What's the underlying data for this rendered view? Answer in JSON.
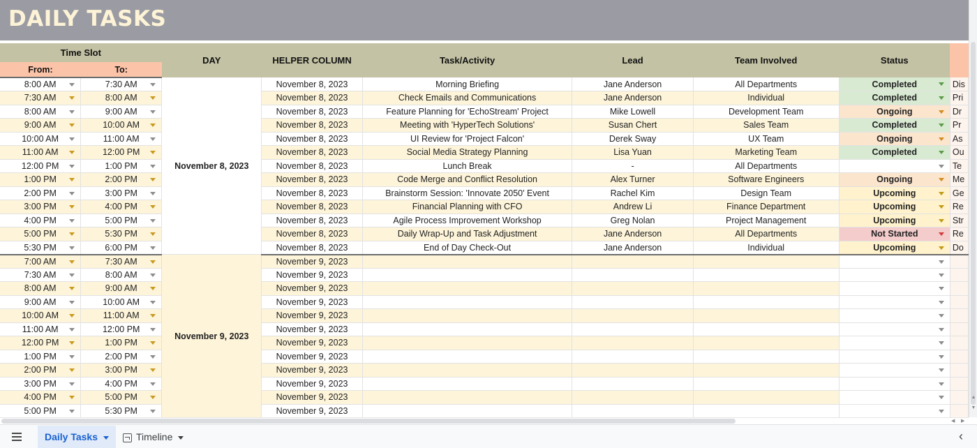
{
  "banner": {
    "title": "DAILY TASKS"
  },
  "headers": {
    "time_slot": "Time Slot",
    "from": "From:",
    "to": "To:",
    "day": "DAY",
    "helper": "HELPER COLUMN",
    "task": "Task/Activity",
    "lead": "Lead",
    "team": "Team Involved",
    "status": "Status"
  },
  "days": [
    {
      "day_label": "November 8, 2023",
      "rows": [
        {
          "from": "8:00 AM",
          "to": "7:30 AM",
          "helper": "November 8, 2023",
          "task": "Morning Briefing",
          "lead": "Jane Anderson",
          "team": "All Departments",
          "status": "Completed",
          "note": "Dis"
        },
        {
          "from": "7:30 AM",
          "to": "8:00 AM",
          "helper": "November 8, 2023",
          "task": "Check Emails and Communications",
          "lead": "Jane Anderson",
          "team": "Individual",
          "status": "Completed",
          "note": "Pri"
        },
        {
          "from": "8:00 AM",
          "to": "9:00 AM",
          "helper": "November 8, 2023",
          "task": "Feature Planning for 'EchoStream' Project",
          "lead": "Mike Lowell",
          "team": "Development Team",
          "status": "Ongoing",
          "note": "Dr"
        },
        {
          "from": "9:00 AM",
          "to": "10:00 AM",
          "helper": "November 8, 2023",
          "task": "Meeting with 'HyperTech Solutions'",
          "lead": "Susan Chert",
          "team": "Sales Team",
          "status": "Completed",
          "note": "Pr"
        },
        {
          "from": "10:00 AM",
          "to": "11:00 AM",
          "helper": "November 8, 2023",
          "task": "UI Review for 'Project Falcon'",
          "lead": "Derek Sway",
          "team": "UX Team",
          "status": "Ongoing",
          "note": "As"
        },
        {
          "from": "11:00 AM",
          "to": "12:00 PM",
          "helper": "November 8, 2023",
          "task": "Social Media Strategy Planning",
          "lead": "Lisa Yuan",
          "team": "Marketing Team",
          "status": "Completed",
          "note": "Ou"
        },
        {
          "from": "12:00 PM",
          "to": "1:00 PM",
          "helper": "November 8, 2023",
          "task": "Lunch Break",
          "lead": "-",
          "team": "All Departments",
          "status": "",
          "note": "Te"
        },
        {
          "from": "1:00 PM",
          "to": "2:00 PM",
          "helper": "November 8, 2023",
          "task": "Code Merge and Conflict Resolution",
          "lead": "Alex Turner",
          "team": "Software Engineers",
          "status": "Ongoing",
          "note": "Me"
        },
        {
          "from": "2:00 PM",
          "to": "3:00 PM",
          "helper": "November 8, 2023",
          "task": "Brainstorm Session: 'Innovate 2050' Event",
          "lead": "Rachel Kim",
          "team": "Design Team",
          "status": "Upcoming",
          "note": "Ge"
        },
        {
          "from": "3:00 PM",
          "to": "4:00 PM",
          "helper": "November 8, 2023",
          "task": "Financial Planning with CFO",
          "lead": "Andrew Li",
          "team": "Finance Department",
          "status": "Upcoming",
          "note": "Re"
        },
        {
          "from": "4:00 PM",
          "to": "5:00 PM",
          "helper": "November 8, 2023",
          "task": "Agile Process Improvement Workshop",
          "lead": "Greg Nolan",
          "team": "Project Management",
          "status": "Upcoming",
          "note": "Str"
        },
        {
          "from": "5:00 PM",
          "to": "5:30 PM",
          "helper": "November 8, 2023",
          "task": "Daily Wrap-Up and Task Adjustment",
          "lead": "Jane Anderson",
          "team": "All Departments",
          "status": "Not Started",
          "note": "Re"
        },
        {
          "from": "5:30 PM",
          "to": "6:00 PM",
          "helper": "November 8, 2023",
          "task": "End of Day Check-Out",
          "lead": "Jane Anderson",
          "team": "Individual",
          "status": "Upcoming",
          "note": "Do"
        }
      ]
    },
    {
      "day_label": "November 9, 2023",
      "rows": [
        {
          "from": "7:00 AM",
          "to": "7:30 AM",
          "helper": "November 9, 2023",
          "task": "",
          "lead": "",
          "team": "",
          "status": "",
          "note": ""
        },
        {
          "from": "7:30 AM",
          "to": "8:00 AM",
          "helper": "November 9, 2023",
          "task": "",
          "lead": "",
          "team": "",
          "status": "",
          "note": ""
        },
        {
          "from": "8:00 AM",
          "to": "9:00 AM",
          "helper": "November 9, 2023",
          "task": "",
          "lead": "",
          "team": "",
          "status": "",
          "note": ""
        },
        {
          "from": "9:00 AM",
          "to": "10:00 AM",
          "helper": "November 9, 2023",
          "task": "",
          "lead": "",
          "team": "",
          "status": "",
          "note": ""
        },
        {
          "from": "10:00 AM",
          "to": "11:00 AM",
          "helper": "November 9, 2023",
          "task": "",
          "lead": "",
          "team": "",
          "status": "",
          "note": ""
        },
        {
          "from": "11:00 AM",
          "to": "12:00 PM",
          "helper": "November 9, 2023",
          "task": "",
          "lead": "",
          "team": "",
          "status": "",
          "note": ""
        },
        {
          "from": "12:00 PM",
          "to": "1:00 PM",
          "helper": "November 9, 2023",
          "task": "",
          "lead": "",
          "team": "",
          "status": "",
          "note": ""
        },
        {
          "from": "1:00 PM",
          "to": "2:00 PM",
          "helper": "November 9, 2023",
          "task": "",
          "lead": "",
          "team": "",
          "status": "",
          "note": ""
        },
        {
          "from": "2:00 PM",
          "to": "3:00 PM",
          "helper": "November 9, 2023",
          "task": "",
          "lead": "",
          "team": "",
          "status": "",
          "note": ""
        },
        {
          "from": "3:00 PM",
          "to": "4:00 PM",
          "helper": "November 9, 2023",
          "task": "",
          "lead": "",
          "team": "",
          "status": "",
          "note": ""
        },
        {
          "from": "4:00 PM",
          "to": "5:00 PM",
          "helper": "November 9, 2023",
          "task": "",
          "lead": "",
          "team": "",
          "status": "",
          "note": ""
        },
        {
          "from": "5:00 PM",
          "to": "5:30 PM",
          "helper": "November 9, 2023",
          "task": "",
          "lead": "",
          "team": "",
          "status": "",
          "note": ""
        }
      ]
    }
  ],
  "status_colors": {
    "Completed": "#d9ead3",
    "Ongoing": "#fce5cd",
    "Upcoming": "#fff2cc",
    "Not Started": "#f4cccc"
  },
  "sheet_tabs": {
    "menu_icon": "hamburger-menu-icon",
    "active": "Daily Tasks",
    "other": "Timeline",
    "other_icon": "timeline-icon",
    "collapse_icon": "chevron-left-icon"
  }
}
